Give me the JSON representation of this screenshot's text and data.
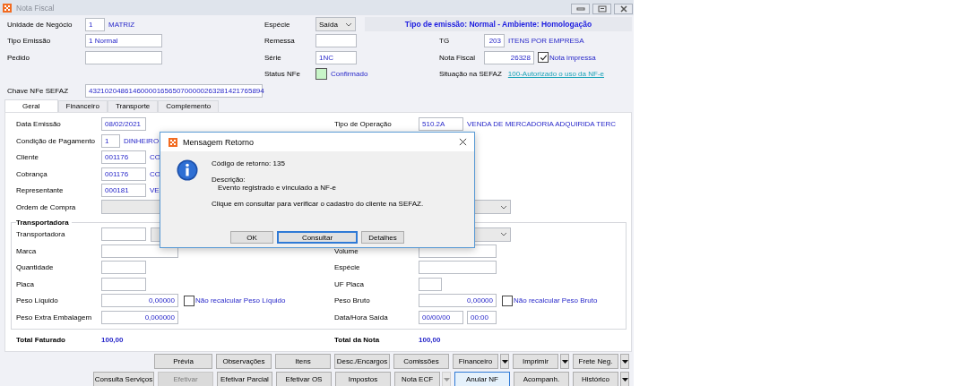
{
  "window": {
    "title": "Nota Fiscal"
  },
  "header": {
    "unidade": {
      "label": "Unidade de Negócio",
      "code": "1",
      "name": "MATRIZ"
    },
    "tipo_emissao": {
      "label": "Tipo Emissão",
      "value": "1 Normal"
    },
    "pedido": {
      "label": "Pedido"
    },
    "chave": {
      "label": "Chave NFe SEFAZ",
      "value": "43210204861460000165650700000263281421765894"
    },
    "especie": {
      "label": "Espécie",
      "value": "Saída"
    },
    "banner": "Tipo de emissão: Normal - Ambiente: Homologação",
    "remessa": {
      "label": "Remessa"
    },
    "serie": {
      "label": "Série",
      "value": "1NC"
    },
    "status_nfe": {
      "label": "Status NFe",
      "value": "Confirmado"
    },
    "tg": {
      "label": "TG",
      "code": "203",
      "name": "ITENS POR EMPRESA"
    },
    "nota_fiscal": {
      "label": "Nota Fiscal",
      "value": "26328",
      "printed_label": "Nota impressa",
      "printed": true
    },
    "situacao": {
      "label": "Situação na SEFAZ",
      "link": "100-Autorizado o uso da NF-e"
    }
  },
  "tabs": [
    {
      "label": "Geral",
      "selected": true
    },
    {
      "label": "Financeiro",
      "selected": false
    },
    {
      "label": "Transporte",
      "selected": false
    },
    {
      "label": "Complemento",
      "selected": false
    }
  ],
  "geral": {
    "data_emissao": {
      "label": "Data Emissão",
      "value": "08/02/2021"
    },
    "condicao": {
      "label": "Condição de Pagamento",
      "code": "1",
      "name": "DINHEIRO"
    },
    "cliente": {
      "label": "Cliente",
      "code": "001176",
      "name": "CO"
    },
    "cobranca": {
      "label": "Cobrança",
      "code": "001176",
      "name": "CO"
    },
    "representante": {
      "label": "Representante",
      "code": "000181",
      "name": "VE"
    },
    "ordem_compra": {
      "label": "Ordem de Compra"
    },
    "tipo_operacao": {
      "label": "Tipo de Operação",
      "code": "510.2A",
      "name": "VENDA DE MERCADORIA ADQUIRIDA TERC"
    },
    "transportadora": {
      "title": "Transportadora",
      "label": "Transportadora",
      "marca": {
        "label": "Marca"
      },
      "volume": {
        "label": "Volume"
      },
      "quantidade": {
        "label": "Quantidade"
      },
      "especie": {
        "label": "Espécie"
      },
      "placa": {
        "label": "Placa"
      },
      "uf_placa": {
        "label": "UF Placa"
      },
      "peso_liquido": {
        "label": "Peso Líquido",
        "value": "0,00000",
        "check_label": "Não recalcular Peso Líquido",
        "checked": false
      },
      "peso_bruto": {
        "label": "Peso Bruto",
        "value": "0,00000",
        "check_label": "Não recalcular Peso Bruto",
        "checked": false
      },
      "peso_extra": {
        "label": "Peso Extra Embalagem",
        "value": "0,000000"
      },
      "data_hora_saida": {
        "label": "Data/Hora Saída",
        "date": "00/00/00",
        "time": "00:00"
      }
    },
    "total_faturado": {
      "label": "Total Faturado",
      "value": "100,00"
    },
    "total_nota": {
      "label": "Total da Nota",
      "value": "100,00"
    }
  },
  "button_rows": [
    [
      {
        "label": "Prévia",
        "disabled": false,
        "focused": false,
        "dropdown": false
      },
      {
        "label": "Observações",
        "disabled": false,
        "focused": false,
        "dropdown": false
      },
      {
        "label": "Itens",
        "disabled": false,
        "focused": false,
        "dropdown": false
      },
      {
        "label": "Desc./Encargos",
        "disabled": false,
        "focused": false,
        "dropdown": false
      },
      {
        "label": "Comissões",
        "disabled": false,
        "focused": false,
        "dropdown": false
      },
      {
        "label": "Financeiro",
        "disabled": false,
        "focused": false,
        "dropdown": true
      },
      {
        "label": "Imprimir",
        "disabled": false,
        "focused": false,
        "dropdown": true
      },
      {
        "label": "Frete Neg.",
        "disabled": false,
        "focused": false,
        "dropdown": true
      }
    ],
    [
      {
        "label": "Consulta Serviços",
        "disabled": false,
        "focused": false,
        "dropdown": false
      },
      {
        "label": "Efetivar",
        "disabled": true,
        "focused": false,
        "dropdown": false
      },
      {
        "label": "Efetivar Parcial",
        "disabled": false,
        "focused": false,
        "dropdown": false
      },
      {
        "label": "Efetivar OS",
        "disabled": false,
        "focused": false,
        "dropdown": false
      },
      {
        "label": "Impostos",
        "disabled": false,
        "focused": false,
        "dropdown": false
      },
      {
        "label": "Nota ECF",
        "disabled": false,
        "focused": false,
        "dropdown": true,
        "dropdown_disabled": true
      },
      {
        "label": "Anular NF",
        "disabled": false,
        "focused": true,
        "dropdown": false
      },
      {
        "label": "Acompanh.",
        "disabled": false,
        "focused": false,
        "dropdown": false
      },
      {
        "label": "Histórico",
        "disabled": false,
        "focused": false,
        "dropdown": true
      }
    ]
  ],
  "dialog": {
    "title": "Mensagem Retorno",
    "code_line": "Código de retorno: 135",
    "description_label": "Descrição:",
    "description": "Evento registrado e vinculado a NF-e",
    "message": "Clique em consultar para verificar o cadastro do cliente na SEFAZ.",
    "buttons": [
      {
        "label": "OK",
        "selected": false
      },
      {
        "label": "Consultar",
        "selected": true
      },
      {
        "label": "Detalhes",
        "selected": false
      }
    ]
  }
}
